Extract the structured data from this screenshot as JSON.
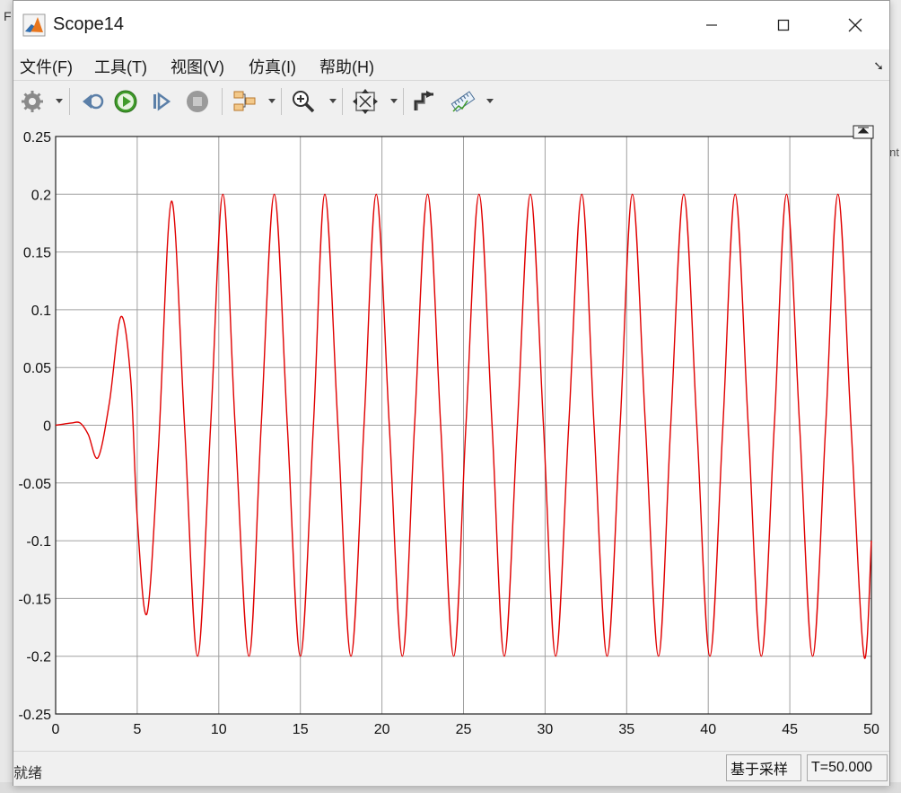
{
  "window": {
    "title": "Scope14"
  },
  "menu": [
    "文件(F)",
    "工具(T)",
    "视图(V)",
    "仿真(I)",
    "帮助(H)"
  ],
  "toolbar": {
    "items": [
      "settings-icon",
      "step-back-icon",
      "run-icon",
      "step-forward-icon",
      "stop-icon",
      "signal-selector-icon",
      "zoom-icon",
      "autoscale-icon",
      "highlight-block-icon",
      "measure-icon"
    ]
  },
  "status": {
    "text": "就绪",
    "mode": "基于采样",
    "time": "T=50.000"
  },
  "colors": {
    "trace": "#e00000",
    "grid": "#a0a0a0"
  },
  "chart_data": {
    "type": "line",
    "title": "",
    "xlabel": "",
    "ylabel": "",
    "xlim": [
      0,
      50
    ],
    "ylim": [
      -0.25,
      0.25
    ],
    "xticks": [
      0,
      5,
      10,
      15,
      20,
      25,
      30,
      35,
      40,
      45,
      50
    ],
    "yticks": [
      0.25,
      0.2,
      0.15,
      0.1,
      0.05,
      0,
      -0.05,
      -0.1,
      -0.15,
      -0.2,
      -0.25
    ],
    "ytick_labels": [
      "0.25",
      "0.2",
      "0.15",
      "0.1",
      "0.05",
      "0",
      "-0.05",
      "-0.1",
      "-0.15",
      "-0.2",
      "-0.25"
    ],
    "grid": true,
    "series": [
      {
        "points": [
          [
            0,
            0
          ],
          [
            0.5,
            0.001
          ],
          [
            1.0,
            0.002
          ],
          [
            1.5,
            0.002
          ],
          [
            2.0,
            -0.008
          ],
          [
            2.6,
            -0.028
          ],
          [
            3.3,
            0.02
          ],
          [
            4.0,
            0.094
          ],
          [
            4.6,
            0.04
          ],
          [
            5.0,
            -0.08
          ],
          [
            5.6,
            -0.163
          ],
          [
            6.3,
            -0.02
          ],
          [
            7.1,
            0.194
          ],
          [
            7.9,
            0.0
          ],
          [
            8.7,
            -0.2
          ],
          [
            9.5,
            0.0
          ],
          [
            10.25,
            0.2
          ],
          [
            11.0,
            0.0
          ],
          [
            11.85,
            -0.2
          ],
          [
            12.6,
            0.0
          ],
          [
            13.4,
            0.2
          ],
          [
            14.2,
            0.0
          ],
          [
            15.0,
            -0.2
          ],
          [
            15.8,
            0.0
          ],
          [
            16.5,
            0.2
          ],
          [
            17.3,
            0.0
          ],
          [
            18.1,
            -0.2
          ],
          [
            18.9,
            0.0
          ],
          [
            19.65,
            0.2
          ],
          [
            20.45,
            0.0
          ],
          [
            21.25,
            -0.2
          ],
          [
            22.0,
            0.0
          ],
          [
            22.8,
            0.2
          ],
          [
            23.6,
            0.0
          ],
          [
            24.4,
            -0.2
          ],
          [
            25.15,
            0.0
          ],
          [
            25.95,
            0.2
          ],
          [
            26.75,
            0.0
          ],
          [
            27.5,
            -0.2
          ],
          [
            28.3,
            0.0
          ],
          [
            29.1,
            0.2
          ],
          [
            29.9,
            0.0
          ],
          [
            30.65,
            -0.2
          ],
          [
            31.45,
            0.0
          ],
          [
            32.25,
            0.2
          ],
          [
            33.0,
            0.0
          ],
          [
            33.8,
            -0.2
          ],
          [
            34.6,
            0.0
          ],
          [
            35.35,
            0.2
          ],
          [
            36.15,
            0.0
          ],
          [
            36.95,
            -0.2
          ],
          [
            37.7,
            0.0
          ],
          [
            38.5,
            0.2
          ],
          [
            39.3,
            0.0
          ],
          [
            40.1,
            -0.2
          ],
          [
            40.9,
            0.0
          ],
          [
            41.65,
            0.2
          ],
          [
            42.45,
            0.0
          ],
          [
            43.25,
            -0.2
          ],
          [
            44.05,
            0.0
          ],
          [
            44.8,
            0.2
          ],
          [
            45.6,
            0.0
          ],
          [
            46.4,
            -0.2
          ],
          [
            47.2,
            0.0
          ],
          [
            47.95,
            0.2
          ],
          [
            48.75,
            0.0
          ],
          [
            49.55,
            -0.2
          ],
          [
            50.0,
            -0.1
          ]
        ]
      }
    ]
  }
}
